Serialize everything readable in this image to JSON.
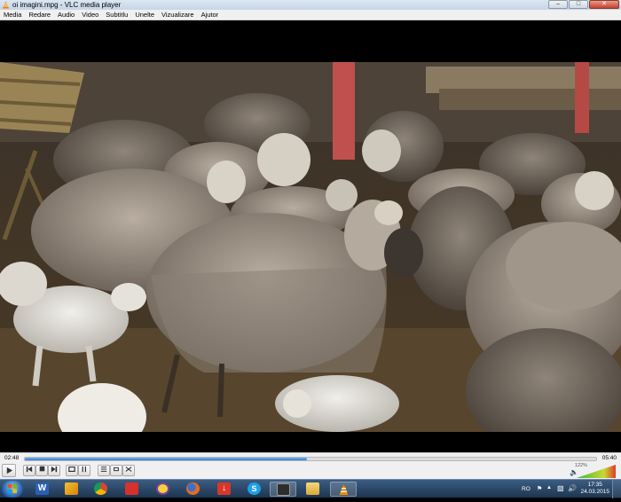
{
  "window": {
    "title": "oi imagini.mpg - VLC media player",
    "minimize_icon": "minimize-icon",
    "maximize_icon": "maximize-icon",
    "close_icon": "close-icon"
  },
  "menu": [
    "Media",
    "Redare",
    "Audio",
    "Video",
    "Subtitlu",
    "Unelte",
    "Vizualizare",
    "Ajutor"
  ],
  "player": {
    "time_elapsed": "02:48",
    "time_total": "05:40",
    "progress_fraction": 0.494,
    "volume_percent": "122%",
    "volume_fraction": 1.0,
    "buttons": [
      "play-icon",
      "previous-icon",
      "stop-icon",
      "next-icon",
      "fullscreen-icon",
      "extended-settings-icon",
      "playlist-icon",
      "loop-icon",
      "shuffle-icon"
    ],
    "accent": "#3a8ee6"
  },
  "video": {
    "scene": "sheep-in-barn"
  },
  "taskbar": {
    "apps": [
      "windows-start-icon",
      "word-icon",
      "winamp-icon",
      "chrome-icon",
      "pdf-icon",
      "yahoo-messenger-icon",
      "firefox-icon",
      "download-icon",
      "skype-icon",
      "media-icon",
      "explorer-folder-icon",
      "vlc-icon"
    ],
    "lang": "RO",
    "time": "17:35",
    "date": "24.03.2015"
  }
}
